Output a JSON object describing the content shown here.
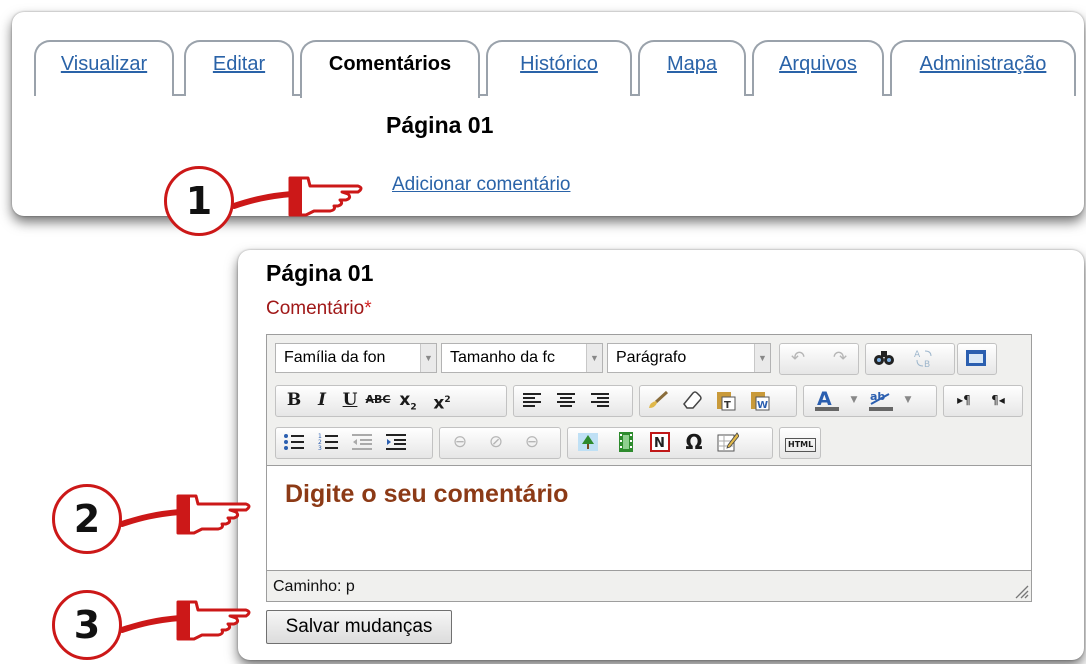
{
  "tabs": [
    {
      "label": "Visualizar"
    },
    {
      "label": "Editar"
    },
    {
      "label": "Comentários"
    },
    {
      "label": "Histórico"
    },
    {
      "label": "Mapa"
    },
    {
      "label": "Arquivos"
    },
    {
      "label": "Administração"
    }
  ],
  "active_tab": "Comentários",
  "top": {
    "page_title": "Página 01",
    "add_comment_link": "Adicionar comentário"
  },
  "form": {
    "page_title": "Página 01",
    "field_label": "Comentário",
    "required_marker": "*",
    "toolbar": {
      "font_family": "Família da fon",
      "font_size": "Tamanho da fc",
      "format": "Parágrafo",
      "html_button": "HTML"
    },
    "content": "Digite o seu comentário",
    "path": "Caminho: p",
    "save_label": "Salvar mudanças"
  },
  "callouts": [
    "1",
    "2",
    "3"
  ],
  "colors": {
    "link": "#2a63a8",
    "callout_red": "#cc1818",
    "label_red": "#a01818",
    "content_text": "#8c3a16"
  }
}
